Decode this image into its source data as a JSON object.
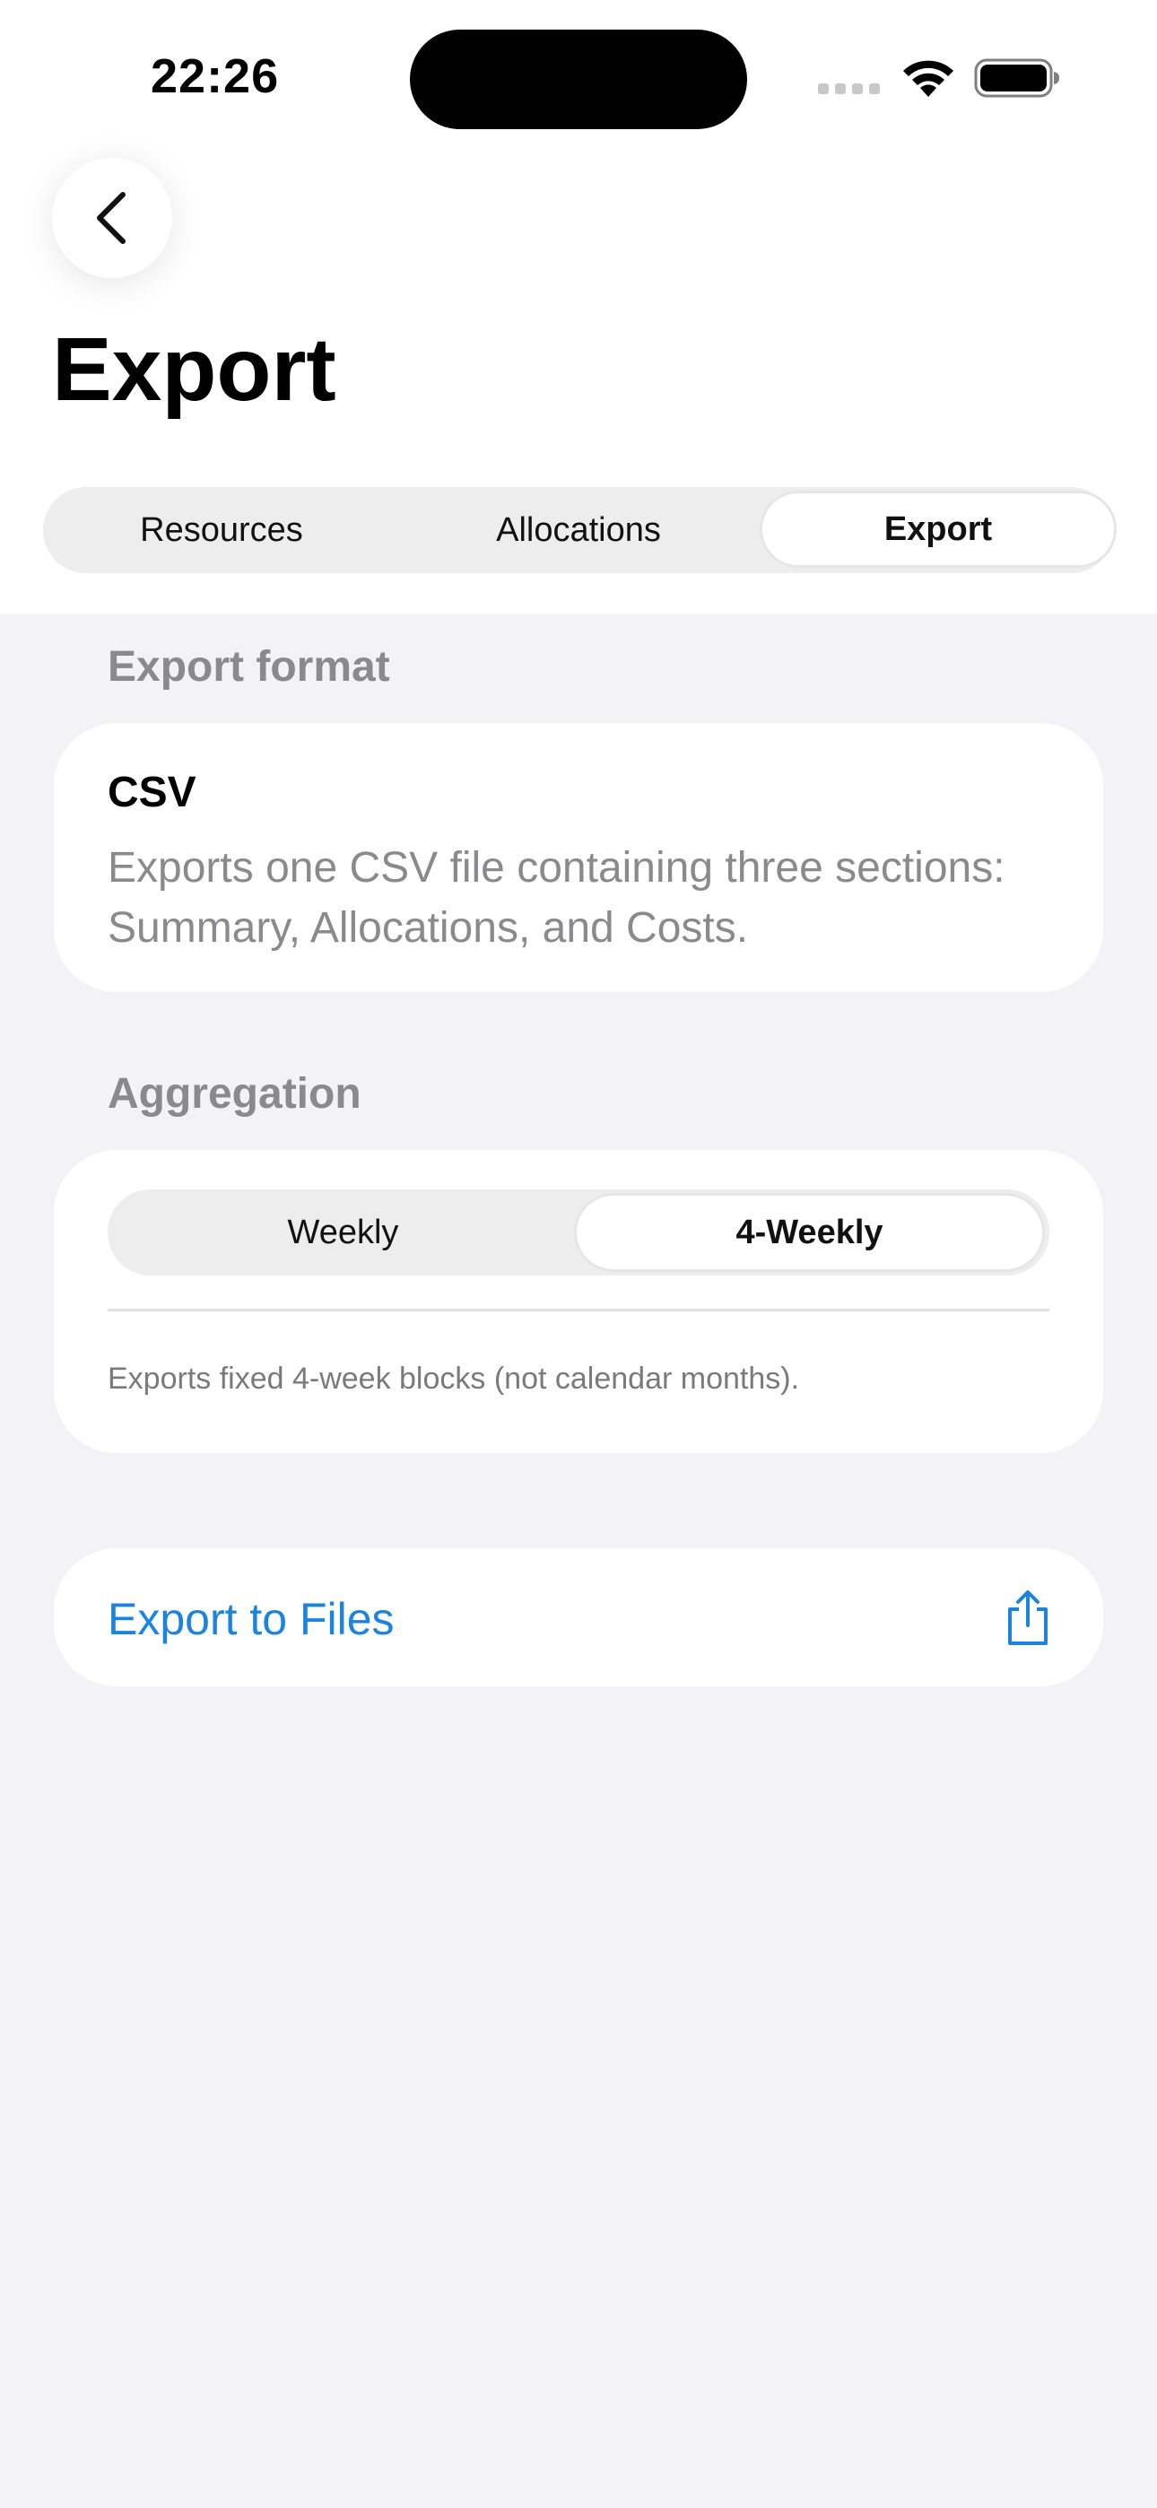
{
  "status_bar": {
    "time": "22:26"
  },
  "nav": {
    "back_icon": "chevron-left-icon",
    "title": "Export"
  },
  "tabs": [
    {
      "label": "Resources",
      "selected": false
    },
    {
      "label": "Allocations",
      "selected": false
    },
    {
      "label": "Export",
      "selected": true
    }
  ],
  "export_format": {
    "header": "Export format",
    "title": "CSV",
    "description": "Exports one CSV file containing three sections: Summary, Allocations, and Costs."
  },
  "aggregation": {
    "header": "Aggregation",
    "options": [
      {
        "label": "Weekly",
        "selected": false
      },
      {
        "label": "4-Weekly",
        "selected": true
      }
    ],
    "footnote": "Exports fixed 4-week blocks (not calendar months)."
  },
  "export_action": {
    "label": "Export to Files",
    "icon": "share-icon"
  },
  "colors": {
    "accent": "#1a84e0",
    "background": "#f2f2f7",
    "secondary_text": "#8a8a8e"
  }
}
